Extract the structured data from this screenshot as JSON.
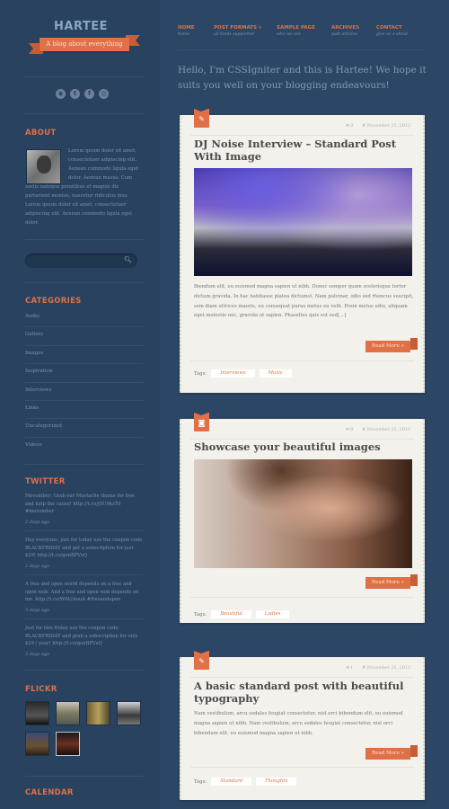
{
  "site": {
    "title": "HARTEE",
    "tagline": "A blog about everything"
  },
  "social": [
    "rss-icon",
    "twitter-icon",
    "facebook-icon",
    "dribbble-icon"
  ],
  "nav": [
    {
      "label": "HOME",
      "sub": "home"
    },
    {
      "label": "POST FORMATS »",
      "sub": "all kinds supported"
    },
    {
      "label": "SAMPLE PAGE",
      "sub": "who we are"
    },
    {
      "label": "ARCHIVES",
      "sub": "past articles"
    },
    {
      "label": "CONTACT",
      "sub": "give us a shout"
    }
  ],
  "intro": "Hello, I'm CSSIgniter and this is Hartee! We hope it suits you well on your blogging endeavours!",
  "about": {
    "title": "ABOUT",
    "text": "Lorem ipsum dolor sit amet, consectetuer adipiscing elit. Aenean commodo ligula eget dolor. Aenean massa. Cum sociis natoque penatibus et magnis dis parturient montes, nascetur ridiculus mus. Lorem ipsum dolor sit amet, consectetuer adipiscing elit. Aenean commodo ligula eget dolor."
  },
  "search": {
    "placeholder": ""
  },
  "categories": {
    "title": "CATEGORIES",
    "items": [
      "Audio",
      "Gallery",
      "Images",
      "Inspiration",
      "Interviews",
      "Links",
      "Uncategorized",
      "Videos"
    ]
  },
  "twitter": {
    "title": "TWITTER",
    "tweets": [
      {
        "text": "Movember: Grab our Mustache theme for free and help the cause! http://t.co/jSU9kzT0 #movember",
        "ago": "2 days ago"
      },
      {
        "text": "Hey everyone, just for today use the coupon code BLACKFRIDAY and get a subscription for just $29! http://t.co/gonBPVuQ",
        "ago": "2 days ago"
      },
      {
        "text": "A free and open world depends on a free and open web. And a free and open web depends on me. http://t.co/WfA2AouA #freeandopen",
        "ago": "3 days ago"
      },
      {
        "text": "Just for this friday use the coupon code BLACKFRIDAY and grab a subscription for only $29 / year! http://t.co/gonBPVuQ",
        "ago": "3 days ago"
      }
    ]
  },
  "flickr": {
    "title": "FLICKR",
    "count": 6
  },
  "calendar": {
    "title": "CALENDAR"
  },
  "posts": [
    {
      "icon": "pencil-icon",
      "comments": "3",
      "date": "# November 21, 2012",
      "title": "DJ Noise Interview – Standard Post With Image",
      "body": "Ibendum elit, eu euismod magna sapien ut nibh. Donec semper quam scelerisque tortor dictum gravida. In hac habitasse platea dictumst. Nam pulvinar, odio sed rhoncus suscipit, sem diam ultrices mauris, eu consequat purus metus eu velit. Proin metus odio, aliquam eget molestie nec, gravida ut sapien. Phasellus quis est sed[...]",
      "read_more": "Read More »",
      "tags_label": "Tags:",
      "tags": [
        "Interviews",
        "Music"
      ]
    },
    {
      "icon": "camera-icon",
      "comments": "0",
      "date": "# November 21, 2012",
      "title": "Showcase your beautiful images",
      "read_more": "Read More »",
      "tags_label": "Tags:",
      "tags": [
        "Beautiful",
        "Ladies"
      ]
    },
    {
      "icon": "pencil-icon",
      "comments": "1",
      "date": "# November 21, 2012",
      "title": "A basic standard post with beautiful typography",
      "body": "Nam vestibulum, arcu sodales feugiat consectetur, nisl orci bibendum elit, eu euismod magna sapien ut nibh. Nam vestibulum, arcu sodales feugiat consectetur, nisl orci bibendum elit, eu euismod magna sapien ut nibh.",
      "read_more": "Read More »",
      "tags_label": "Tags:",
      "tags": [
        "Standard",
        "Thoughts"
      ]
    }
  ]
}
